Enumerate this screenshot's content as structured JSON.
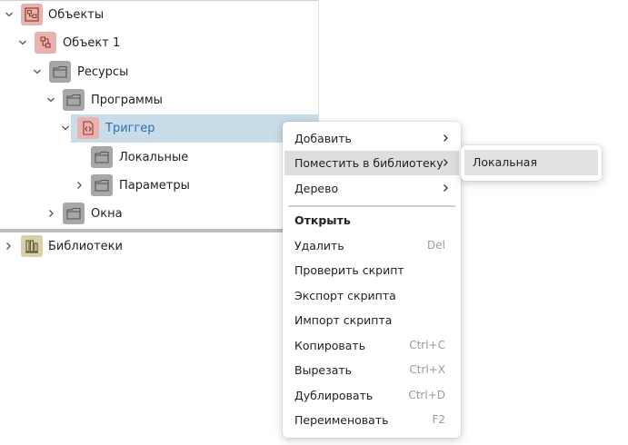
{
  "tree": {
    "items": [
      {
        "label": "Объекты",
        "icon": "objects-icon"
      },
      {
        "label": "Объект 1",
        "icon": "object-icon"
      },
      {
        "label": "Ресурсы",
        "icon": "folder-icon"
      },
      {
        "label": "Программы",
        "icon": "folder-icon"
      },
      {
        "label": "Триггер",
        "icon": "trigger-script-icon"
      },
      {
        "label": "Локальные",
        "icon": "folder-icon"
      },
      {
        "label": "Параметры",
        "icon": "folder-icon"
      },
      {
        "label": "Окна",
        "icon": "folder-icon"
      }
    ],
    "libraries": {
      "label": "Библиотеки",
      "icon": "library-icon"
    }
  },
  "context_menu": {
    "items": [
      {
        "label": "Добавить",
        "submenu": true
      },
      {
        "label": "Поместить в библиотеку",
        "submenu": true,
        "highlighted": true
      },
      {
        "label": "Дерево",
        "submenu": true
      },
      {
        "label": "Открыть",
        "bold": true
      },
      {
        "label": "Удалить",
        "shortcut": "Del"
      },
      {
        "label": "Проверить скрипт"
      },
      {
        "label": "Экспорт скрипта"
      },
      {
        "label": "Импорт скрипта"
      },
      {
        "label": "Копировать",
        "shortcut": "Ctrl+C"
      },
      {
        "label": "Вырезать",
        "shortcut": "Ctrl+X"
      },
      {
        "label": "Дублировать",
        "shortcut": "Ctrl+D"
      },
      {
        "label": "Переименовать",
        "shortcut": "F2"
      }
    ]
  },
  "submenu": {
    "items": [
      {
        "label": "Локальная"
      }
    ]
  },
  "colors": {
    "selection": "#c9dde9",
    "selected_text": "#2c6fb0",
    "object_icon_bg": "#e9b2ad",
    "folder_icon_bg": "#a7a7a7",
    "library_icon_bg": "#d8d0a8",
    "menu_highlight": "#dedede"
  }
}
